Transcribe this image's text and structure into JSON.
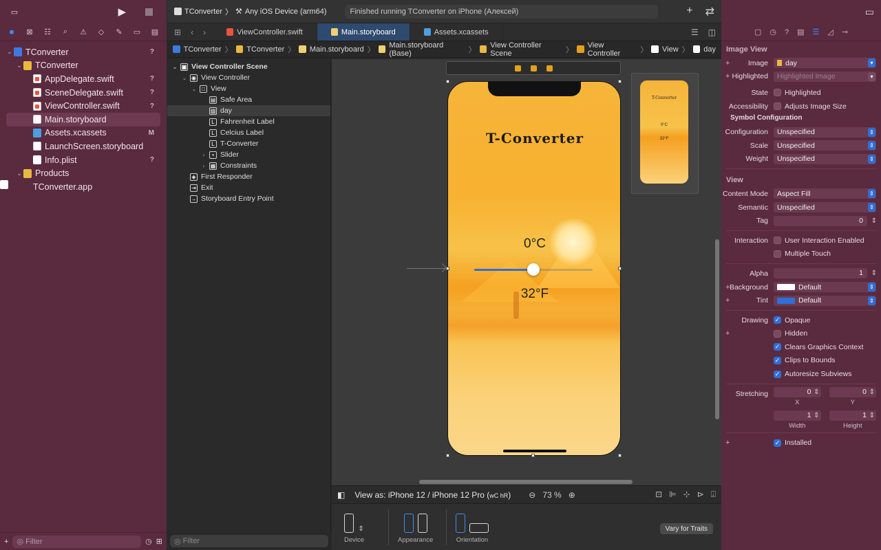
{
  "toolbar": {
    "scheme": "TConverter",
    "device": "Any iOS Device (arm64)",
    "status": "Finished running TConverter on iPhone (Алексей)"
  },
  "navigator": {
    "items": [
      {
        "label": "TConverter",
        "badge": "?",
        "kind": "proj",
        "depth": 0
      },
      {
        "label": "TConverter",
        "badge": "",
        "kind": "folder",
        "depth": 1
      },
      {
        "label": "AppDelegate.swift",
        "badge": "?",
        "kind": "swift",
        "depth": 2
      },
      {
        "label": "SceneDelegate.swift",
        "badge": "?",
        "kind": "swift",
        "depth": 2
      },
      {
        "label": "ViewController.swift",
        "badge": "?",
        "kind": "swift",
        "depth": 2
      },
      {
        "label": "Main.storyboard",
        "badge": "",
        "kind": "sb",
        "depth": 2,
        "selected": true
      },
      {
        "label": "Assets.xcassets",
        "badge": "M",
        "kind": "asset",
        "depth": 2
      },
      {
        "label": "LaunchScreen.storyboard",
        "badge": "",
        "kind": "sb",
        "depth": 2
      },
      {
        "label": "Info.plist",
        "badge": "?",
        "kind": "plist",
        "depth": 2
      },
      {
        "label": "Products",
        "badge": "",
        "kind": "folder",
        "depth": 1
      },
      {
        "label": "TConverter.app",
        "badge": "",
        "kind": "app",
        "depth": 2
      }
    ],
    "filter_placeholder": "Filter"
  },
  "tabs": [
    "ViewController.swift",
    "Main.storyboard",
    "Assets.xcassets"
  ],
  "breadcrumbs": [
    "TConverter",
    "TConverter",
    "Main.storyboard",
    "Main.storyboard (Base)",
    "View Controller Scene",
    "View Controller",
    "View",
    "day"
  ],
  "outline": {
    "items": [
      {
        "label": "View Controller Scene",
        "glyph": "▣",
        "depth": 0,
        "bold": true
      },
      {
        "label": "View Controller",
        "glyph": "◉",
        "depth": 1
      },
      {
        "label": "View",
        "glyph": "□",
        "depth": 2
      },
      {
        "label": "Safe Area",
        "glyph": "▤",
        "depth": 3
      },
      {
        "label": "day",
        "glyph": "▨",
        "depth": 3,
        "selected": true
      },
      {
        "label": "Fahrenheit Label",
        "glyph": "L",
        "depth": 3
      },
      {
        "label": "Celcius Label",
        "glyph": "L",
        "depth": 3
      },
      {
        "label": "T-Converter",
        "glyph": "L",
        "depth": 3
      },
      {
        "label": "Slider",
        "glyph": "•",
        "depth": 3,
        "chev": true
      },
      {
        "label": "Constraints",
        "glyph": "▦",
        "depth": 3,
        "chev": true
      },
      {
        "label": "First Responder",
        "glyph": "◈",
        "depth": 1
      },
      {
        "label": "Exit",
        "glyph": "⇥",
        "depth": 1
      },
      {
        "label": "Storyboard Entry Point",
        "glyph": "→",
        "depth": 1
      }
    ],
    "filter_placeholder": "Filter"
  },
  "phone": {
    "title": "T-Converter",
    "celsius": "0°C",
    "fahrenheit": "32°F",
    "slider_value": 0.5
  },
  "mini": {
    "title": "T-Converter",
    "celsius": "0°C",
    "fahrenheit": "32°F"
  },
  "canvas_bar": {
    "view_as": "View as: iPhone 12 / iPhone 12 Pro (",
    "size_class": "wC hR",
    "close": ")",
    "zoom": "73 %"
  },
  "device_bar": {
    "device": "Device",
    "appearance": "Appearance",
    "orientation": "Orientation",
    "vary": "Vary for Traits"
  },
  "inspector": {
    "image_view_title": "Image View",
    "image": "day",
    "highlighted_placeholder": "Highlighted Image",
    "state_label": "Highlighted",
    "accessibility_label": "Adjusts Image Size",
    "symbol_title": "Symbol Configuration",
    "configuration": "Unspecified",
    "scale": "Unspecified",
    "weight": "Unspecified",
    "view_title": "View",
    "content_mode": "Aspect Fill",
    "semantic": "Unspecified",
    "tag": "0",
    "interaction1": "User Interaction Enabled",
    "interaction2": "Multiple Touch",
    "alpha": "1",
    "background": "Default",
    "tint": "Default",
    "drawing": [
      "Opaque",
      "Hidden",
      "Clears Graphics Context",
      "Clips to Bounds",
      "Autoresize Subviews"
    ],
    "drawing_on": [
      true,
      false,
      true,
      true,
      true
    ],
    "stretch_x": "0",
    "stretch_y": "0",
    "stretch_w": "1",
    "stretch_h": "1",
    "installed": "Installed",
    "labels": {
      "image": "Image",
      "highlighted": "Highlighted",
      "state": "State",
      "accessibility": "Accessibility",
      "configuration": "Configuration",
      "scale": "Scale",
      "weight": "Weight",
      "content_mode": "Content Mode",
      "semantic": "Semantic",
      "tag": "Tag",
      "interaction": "Interaction",
      "alpha": "Alpha",
      "background": "Background",
      "tint": "Tint",
      "drawing": "Drawing",
      "stretching": "Stretching",
      "x": "X",
      "y": "Y",
      "width": "Width",
      "height": "Height"
    }
  }
}
